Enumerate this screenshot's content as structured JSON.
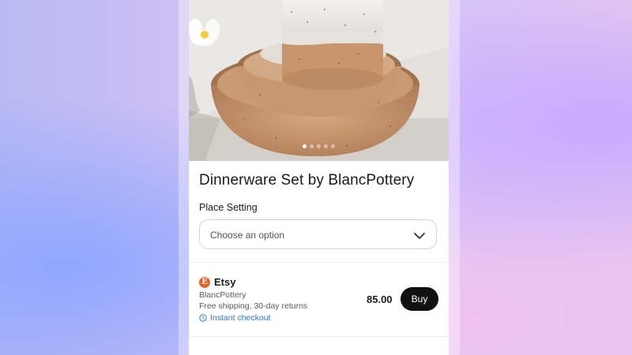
{
  "product": {
    "title": "Dinnerware Set by BlancPottery",
    "image_icon": "pottery-photo",
    "carousel": {
      "count": 5,
      "active_index": 0
    }
  },
  "option": {
    "label": "Place Setting",
    "placeholder": "Choose an option"
  },
  "offer": {
    "merchant_icon": "etsy-logo",
    "merchant_logo_letter": "E",
    "merchant": "Etsy",
    "seller": "BlancPottery",
    "shipping": "Free shipping, 30-day returns",
    "checkout": "Instant checkout",
    "price": "85.00",
    "buy_label": "Buy",
    "accent_color": "#2a77d6",
    "merchant_color": "#e8632b"
  }
}
